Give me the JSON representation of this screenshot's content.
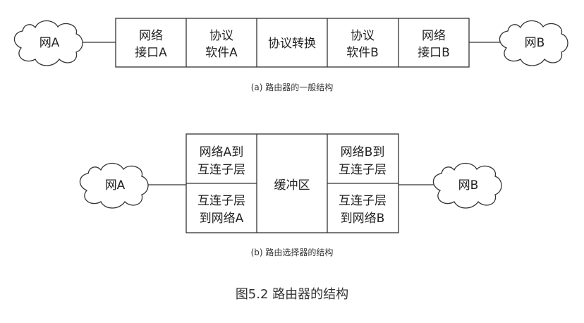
{
  "diagram_a": {
    "cloud_left": "网A",
    "cloud_right": "网B",
    "cells": [
      [
        "网络",
        "接口A"
      ],
      [
        "协议",
        "软件A"
      ],
      [
        "协议转换"
      ],
      [
        "协议",
        "软件B"
      ],
      [
        "网络",
        "接口B"
      ]
    ],
    "caption": "(a) 路由器的一般结构"
  },
  "diagram_b": {
    "cloud_left": "网A",
    "cloud_right": "网B",
    "left_top": [
      "网络A到",
      "互连子层"
    ],
    "left_bottom": [
      "互连子层",
      "到网络A"
    ],
    "center": "缓冲区",
    "right_top": [
      "网络B到",
      "互连子层"
    ],
    "right_bottom": [
      "互连子层",
      "到网络B"
    ],
    "caption": "(b) 路由选择器的结构"
  },
  "figure_title": "图5.2 路由器的结构"
}
